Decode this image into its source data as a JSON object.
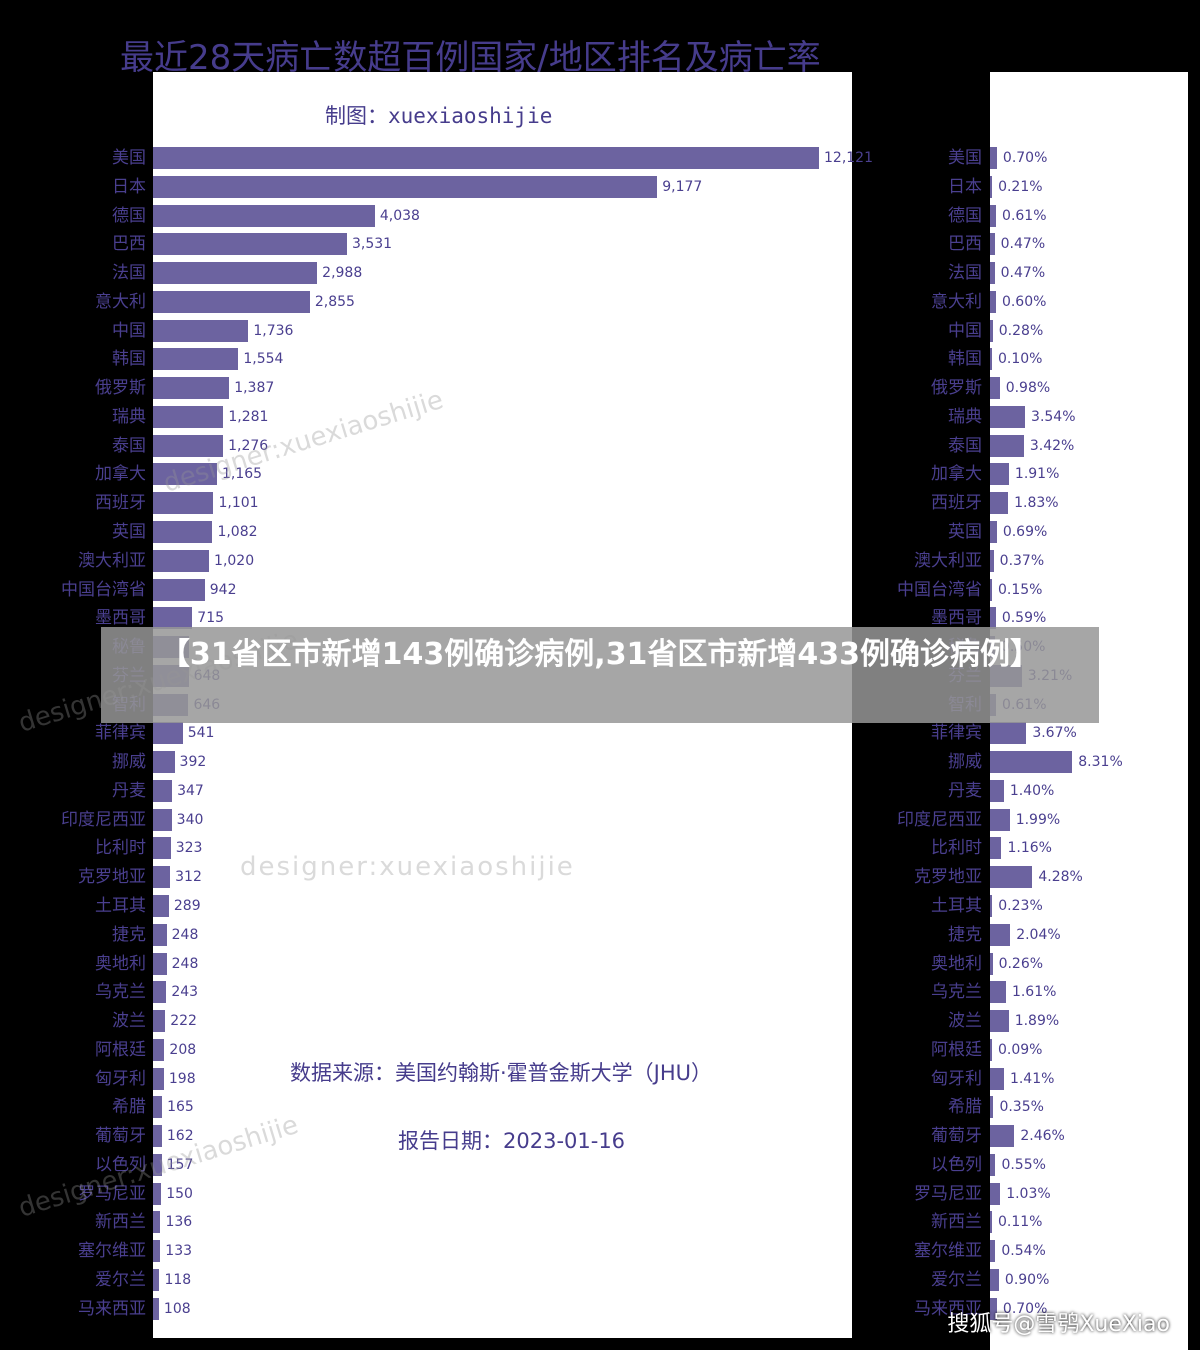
{
  "banner": "【31省区市新增143例确诊病例,31省区市新增433例确诊病例】",
  "footer": "搜狐号@雪鸮XueXiao",
  "watermarks": [
    "designer:xuexiaoshijie",
    "designer:xuexiaoshijie",
    "designer:xuexiaoshijie",
    "designer:xuexiaoshijie"
  ],
  "chart_data": [
    {
      "type": "bar",
      "orientation": "horizontal",
      "title": "最近28天病亡数超百例国家/地区排名及病亡率",
      "subtitle": "制图：xuexiaoshijie",
      "source": "数据来源：美国约翰斯·霍普金斯大学（JHU）",
      "report_date": "报告日期：2023-01-16",
      "color": "#6c63a0",
      "categories": [
        "美国",
        "日本",
        "德国",
        "巴西",
        "法国",
        "意大利",
        "中国",
        "韩国",
        "俄罗斯",
        "瑞典",
        "泰国",
        "加拿大",
        "西班牙",
        "英国",
        "澳大利亚",
        "中国台湾省",
        "墨西哥",
        "秘鲁",
        "芬兰",
        "智利",
        "菲律宾",
        "挪威",
        "丹麦",
        "印度尼西亚",
        "比利时",
        "克罗地亚",
        "土耳其",
        "捷克",
        "奥地利",
        "乌克兰",
        "波兰",
        "阿根廷",
        "匈牙利",
        "希腊",
        "葡萄牙",
        "以色列",
        "罗马尼亚",
        "新西兰",
        "塞尔维亚",
        "爱尔兰",
        "马来西亚"
      ],
      "values": [
        12121,
        9177,
        4038,
        3531,
        2988,
        2855,
        1736,
        1554,
        1387,
        1281,
        1276,
        1165,
        1101,
        1082,
        1020,
        942,
        715,
        660,
        648,
        646,
        541,
        392,
        347,
        340,
        323,
        312,
        289,
        248,
        248,
        243,
        222,
        208,
        198,
        165,
        162,
        157,
        150,
        136,
        133,
        118,
        108
      ],
      "labels": [
        "12,121",
        "9,177",
        "4,038",
        "3,531",
        "2,988",
        "2,855",
        "1,736",
        "1,554",
        "1,387",
        "1,281",
        "1,276",
        "1,165",
        "1,101",
        "1,082",
        "1,020",
        "942",
        "715",
        "",
        "648",
        "646",
        "541",
        "392",
        "347",
        "340",
        "323",
        "312",
        "289",
        "248",
        "248",
        "243",
        "222",
        "208",
        "198",
        "165",
        "162",
        "157",
        "150",
        "136",
        "133",
        "118",
        "108"
      ],
      "xlim": [
        0,
        12121
      ]
    },
    {
      "type": "bar",
      "orientation": "horizontal",
      "color": "#6c63a0",
      "categories": [
        "美国",
        "日本",
        "德国",
        "巴西",
        "法国",
        "意大利",
        "中国",
        "韩国",
        "俄罗斯",
        "瑞典",
        "泰国",
        "加拿大",
        "西班牙",
        "英国",
        "澳大利亚",
        "中国台湾省",
        "墨西哥",
        "秘鲁",
        "芬兰",
        "智利",
        "菲律宾",
        "挪威",
        "丹麦",
        "印度尼西亚",
        "比利时",
        "克罗地亚",
        "土耳其",
        "捷克",
        "奥地利",
        "乌克兰",
        "波兰",
        "阿根廷",
        "匈牙利",
        "希腊",
        "葡萄牙",
        "以色列",
        "罗马尼亚",
        "新西兰",
        "塞尔维亚",
        "爱尔兰",
        "马来西亚"
      ],
      "values": [
        0.7,
        0.21,
        0.61,
        0.47,
        0.47,
        0.6,
        0.28,
        0.1,
        0.98,
        3.54,
        3.42,
        1.91,
        1.83,
        0.69,
        0.37,
        0.15,
        0.59,
        0.5,
        3.21,
        0.61,
        3.67,
        8.31,
        1.4,
        1.99,
        1.16,
        4.28,
        0.23,
        2.04,
        0.26,
        1.61,
        1.89,
        0.09,
        1.41,
        0.35,
        2.46,
        0.55,
        1.03,
        0.11,
        0.54,
        0.9,
        0.7
      ],
      "unit": "%"
    }
  ]
}
